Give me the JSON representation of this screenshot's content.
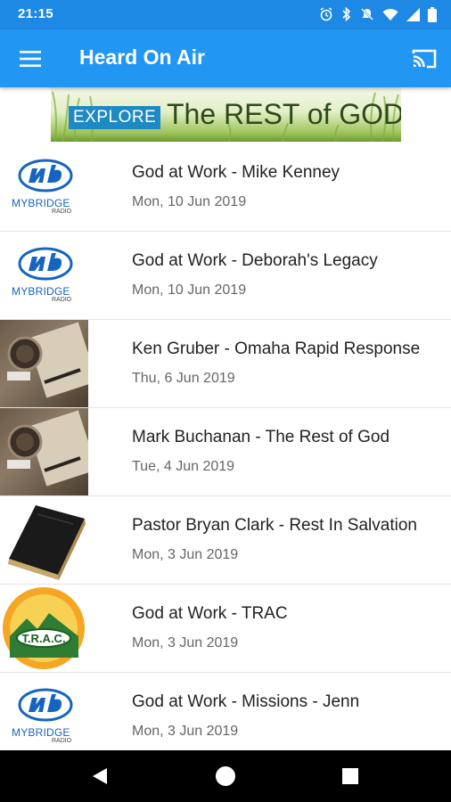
{
  "status_bar": {
    "time": "21:15",
    "icons": [
      "alarm-icon",
      "bluetooth-icon",
      "mute-icon",
      "wifi-icon",
      "signal-icon",
      "battery-icon"
    ]
  },
  "app_bar": {
    "title": "Heard On Air",
    "menu_icon": "menu-icon",
    "cast_icon": "cast-icon",
    "background_color": "#2196f3"
  },
  "banner": {
    "explore_label": "EXPLORE",
    "headline": "The REST of GOD"
  },
  "logos": {
    "mybridge_name": "MYBRIDGE",
    "mybridge_sub": "RADIO",
    "trac_text": "T.R.A.C."
  },
  "items": [
    {
      "title": "God at Work - Mike Kenney",
      "date": "Mon, 10 Jun 2019",
      "thumbnail": "mybridge-logo"
    },
    {
      "title": "God at Work - Deborah's Legacy",
      "date": "Mon, 10 Jun 2019",
      "thumbnail": "mybridge-logo"
    },
    {
      "title": "Ken Gruber - Omaha Rapid Response",
      "date": "Thu, 6 Jun 2019",
      "thumbnail": "desk-photo"
    },
    {
      "title": "Mark Buchanan - The Rest of God",
      "date": "Tue, 4 Jun 2019",
      "thumbnail": "desk-photo"
    },
    {
      "title": "Pastor Bryan Clark - Rest In Salvation",
      "date": "Mon, 3 Jun 2019",
      "thumbnail": "bible-photo"
    },
    {
      "title": "God at Work - TRAC",
      "date": "Mon, 3 Jun 2019",
      "thumbnail": "trac-logo"
    },
    {
      "title": "God at Work - Missions - Jenn",
      "date": "Mon, 3 Jun 2019",
      "thumbnail": "mybridge-logo"
    }
  ],
  "nav_bar": {
    "back_icon": "back-icon",
    "home_icon": "home-icon",
    "recents_icon": "recents-icon"
  }
}
